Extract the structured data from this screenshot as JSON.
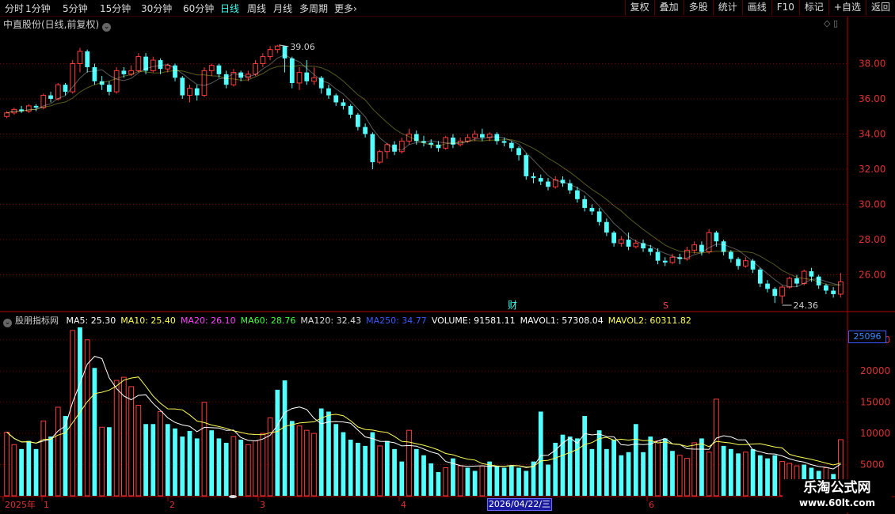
{
  "toolbar": {
    "periods": [
      "分时",
      "1分钟",
      "5分钟",
      "15分钟",
      "30分钟",
      "60分钟",
      "日线",
      "周线",
      "月线",
      "多周期",
      "更多"
    ],
    "active_index": 6,
    "right_buttons": [
      "复权",
      "叠加",
      "多股",
      "统计",
      "画线",
      "F10",
      "标记",
      "+自选",
      "返回"
    ]
  },
  "stock": {
    "title": "中直股份(日线,前复权)"
  },
  "indicator": {
    "name": "股朋指标网",
    "items": [
      {
        "label": "MA5: 25.30",
        "color": "#ffffff"
      },
      {
        "label": "MA10: 25.40",
        "color": "#ffff55"
      },
      {
        "label": "MA20: 26.10",
        "color": "#ff44ff"
      },
      {
        "label": "MA60: 28.76",
        "color": "#44ff44"
      },
      {
        "label": "MA120: 32.43",
        "color": "#dddddd"
      },
      {
        "label": "MA250: 34.77",
        "color": "#3a5aff"
      },
      {
        "label": "VOLUME: 91581.11",
        "color": "#ffffff"
      },
      {
        "label": "MAVOL1: 57308.04",
        "color": "#ffffff"
      },
      {
        "label": "MAVOL2: 60311.82",
        "color": "#ffff55"
      }
    ]
  },
  "markers": {
    "fin": "财",
    "s": "S"
  },
  "cursor": {
    "value": "25096",
    "date": "2026/04/22/三"
  },
  "watermark": {
    "title": "乐淘公式网",
    "url": "www.60lt.com"
  },
  "colors": {
    "up": "#ff3c3c",
    "down": "#54ffff",
    "grid": "#7a0000",
    "bg": "#000000"
  },
  "chart_data": {
    "type": "candlestick",
    "price_ticks": [
      "38.00",
      "36.00",
      "34.00",
      "32.00",
      "30.00",
      "28.00",
      "26.00"
    ],
    "volume_ticks": [
      "25000",
      "20000",
      "15000",
      "10000",
      "5000"
    ],
    "price_ylim": [
      24.0,
      40.0
    ],
    "volume_ylim": [
      0,
      27000
    ],
    "x_labels": [
      "2025年",
      "1",
      "2",
      "3",
      "4",
      "6"
    ],
    "high_label": "39.06",
    "low_label": "24.36",
    "candles": [
      [
        35.0,
        35.2,
        34.9,
        35.3
      ],
      [
        35.2,
        35.4,
        35.1,
        35.5
      ],
      [
        35.4,
        35.3,
        35.2,
        35.6
      ],
      [
        35.3,
        35.6,
        35.2,
        35.7
      ],
      [
        35.6,
        35.5,
        35.3,
        35.7
      ],
      [
        35.5,
        36.2,
        35.4,
        36.3
      ],
      [
        36.2,
        36.0,
        35.8,
        36.4
      ],
      [
        36.0,
        36.8,
        35.9,
        36.9
      ],
      [
        36.8,
        36.4,
        36.2,
        36.9
      ],
      [
        36.4,
        38.0,
        36.3,
        38.2
      ],
      [
        38.0,
        38.7,
        37.5,
        38.9
      ],
      [
        38.7,
        37.8,
        37.5,
        38.8
      ],
      [
        37.8,
        37.0,
        36.8,
        38.0
      ],
      [
        37.0,
        36.8,
        36.5,
        37.3
      ],
      [
        36.8,
        36.4,
        36.2,
        37.0
      ],
      [
        36.4,
        37.6,
        36.3,
        37.8
      ],
      [
        37.6,
        37.4,
        37.2,
        37.8
      ],
      [
        37.4,
        37.6,
        37.3,
        37.9
      ],
      [
        37.6,
        38.4,
        37.5,
        38.6
      ],
      [
        38.4,
        37.6,
        37.4,
        38.6
      ],
      [
        37.6,
        38.2,
        37.5,
        38.4
      ],
      [
        38.2,
        37.7,
        37.4,
        38.3
      ],
      [
        37.7,
        37.9,
        37.5,
        38.0
      ],
      [
        37.9,
        37.2,
        37.0,
        38.0
      ],
      [
        37.2,
        36.2,
        36.0,
        37.3
      ],
      [
        36.2,
        36.6,
        35.8,
        36.8
      ],
      [
        36.6,
        36.2,
        35.9,
        36.8
      ],
      [
        36.2,
        37.6,
        36.1,
        37.8
      ],
      [
        37.6,
        37.9,
        37.3,
        38.0
      ],
      [
        37.9,
        37.4,
        37.2,
        38.0
      ],
      [
        37.4,
        36.8,
        36.6,
        37.6
      ],
      [
        36.8,
        37.5,
        36.7,
        37.7
      ],
      [
        37.5,
        37.2,
        37.0,
        37.6
      ],
      [
        37.2,
        37.4,
        37.0,
        37.6
      ],
      [
        37.4,
        38.0,
        37.3,
        38.2
      ],
      [
        38.0,
        38.4,
        37.8,
        38.6
      ],
      [
        38.4,
        38.8,
        38.2,
        39.0
      ],
      [
        38.8,
        39.0,
        38.6,
        39.06
      ],
      [
        39.0,
        38.3,
        37.5,
        39.0
      ],
      [
        38.3,
        36.9,
        36.6,
        38.4
      ],
      [
        36.9,
        37.5,
        36.5,
        37.8
      ],
      [
        37.5,
        37.0,
        36.8,
        38.2
      ],
      [
        37.0,
        37.2,
        36.8,
        37.8
      ],
      [
        37.2,
        36.6,
        36.3,
        37.3
      ],
      [
        36.6,
        36.2,
        36.0,
        36.8
      ],
      [
        36.2,
        35.8,
        35.6,
        36.3
      ],
      [
        35.8,
        35.6,
        35.4,
        36.0
      ],
      [
        35.6,
        35.1,
        34.9,
        35.7
      ],
      [
        35.1,
        34.4,
        34.2,
        35.2
      ],
      [
        34.4,
        34.0,
        33.8,
        34.6
      ],
      [
        34.0,
        32.4,
        32.0,
        34.1
      ],
      [
        32.4,
        33.0,
        32.3,
        33.1
      ],
      [
        33.0,
        33.4,
        32.6,
        33.5
      ],
      [
        33.4,
        33.0,
        32.8,
        33.6
      ],
      [
        33.0,
        33.6,
        32.9,
        33.8
      ],
      [
        33.6,
        34.0,
        33.4,
        34.3
      ],
      [
        34.0,
        33.6,
        33.4,
        34.2
      ],
      [
        33.6,
        33.5,
        33.3,
        33.9
      ],
      [
        33.5,
        33.4,
        33.2,
        33.7
      ],
      [
        33.4,
        33.2,
        33.0,
        33.6
      ],
      [
        33.2,
        33.8,
        33.1,
        33.9
      ],
      [
        33.8,
        33.4,
        33.2,
        34.0
      ],
      [
        33.4,
        33.6,
        33.3,
        33.8
      ],
      [
        33.6,
        33.8,
        33.5,
        34.0
      ],
      [
        33.8,
        34.0,
        33.6,
        34.2
      ],
      [
        34.0,
        33.8,
        33.6,
        34.3
      ],
      [
        33.8,
        34.0,
        33.6,
        34.1
      ],
      [
        34.0,
        33.6,
        33.4,
        34.1
      ],
      [
        33.6,
        33.5,
        33.3,
        33.8
      ],
      [
        33.5,
        33.2,
        33.0,
        33.6
      ],
      [
        33.2,
        32.8,
        32.5,
        33.3
      ],
      [
        32.8,
        31.6,
        31.4,
        32.9
      ],
      [
        31.6,
        31.5,
        31.2,
        31.8
      ],
      [
        31.5,
        31.3,
        31.1,
        31.7
      ],
      [
        31.3,
        31.0,
        30.8,
        31.5
      ],
      [
        31.0,
        31.4,
        30.9,
        31.6
      ],
      [
        31.4,
        31.2,
        31.0,
        31.6
      ],
      [
        31.2,
        30.8,
        30.6,
        31.4
      ],
      [
        30.8,
        30.3,
        30.1,
        31.0
      ],
      [
        30.3,
        29.8,
        29.6,
        30.5
      ],
      [
        29.8,
        29.6,
        29.4,
        30.0
      ],
      [
        29.6,
        29.0,
        28.8,
        29.8
      ],
      [
        29.0,
        28.4,
        28.2,
        29.2
      ],
      [
        28.4,
        27.8,
        27.6,
        28.5
      ],
      [
        27.8,
        28.0,
        27.6,
        28.2
      ],
      [
        28.0,
        27.6,
        27.4,
        28.4
      ],
      [
        27.6,
        27.8,
        27.5,
        28.0
      ],
      [
        27.8,
        27.5,
        27.3,
        28.0
      ],
      [
        27.5,
        27.3,
        27.1,
        27.7
      ],
      [
        27.3,
        26.8,
        26.6,
        27.5
      ],
      [
        26.8,
        26.7,
        26.5,
        27.0
      ],
      [
        26.7,
        27.0,
        26.6,
        27.2
      ],
      [
        27.0,
        26.9,
        26.6,
        27.2
      ],
      [
        26.9,
        27.4,
        26.8,
        27.6
      ],
      [
        27.4,
        27.7,
        27.2,
        27.9
      ],
      [
        27.7,
        27.3,
        27.1,
        27.9
      ],
      [
        27.3,
        28.4,
        27.2,
        28.6
      ],
      [
        28.4,
        27.9,
        27.6,
        28.5
      ],
      [
        27.9,
        27.3,
        27.1,
        28.0
      ],
      [
        27.3,
        26.9,
        26.7,
        27.4
      ],
      [
        26.9,
        26.5,
        26.3,
        27.0
      ],
      [
        26.5,
        26.8,
        26.4,
        27.0
      ],
      [
        26.8,
        26.3,
        26.1,
        26.9
      ],
      [
        26.3,
        25.5,
        25.3,
        26.4
      ],
      [
        25.5,
        25.2,
        25.0,
        25.7
      ],
      [
        25.2,
        24.8,
        24.4,
        25.3
      ],
      [
        24.8,
        25.3,
        24.36,
        25.4
      ],
      [
        25.3,
        25.8,
        25.2,
        25.9
      ],
      [
        25.8,
        25.5,
        25.3,
        26.0
      ],
      [
        25.5,
        26.2,
        25.4,
        26.3
      ],
      [
        26.2,
        25.9,
        25.6,
        26.4
      ],
      [
        25.9,
        25.4,
        25.2,
        26.0
      ],
      [
        25.4,
        25.1,
        24.9,
        25.5
      ],
      [
        25.1,
        24.9,
        24.7,
        25.3
      ],
      [
        24.9,
        25.6,
        24.7,
        26.1
      ]
    ],
    "volumes": [
      [
        10200,
        1
      ],
      [
        8200,
        1
      ],
      [
        7500,
        0
      ],
      [
        8800,
        0
      ],
      [
        7500,
        0
      ],
      [
        12000,
        1
      ],
      [
        9500,
        0
      ],
      [
        14200,
        1
      ],
      [
        12800,
        0
      ],
      [
        26500,
        1
      ],
      [
        27000,
        0
      ],
      [
        25000,
        1
      ],
      [
        20500,
        0
      ],
      [
        11000,
        1
      ],
      [
        11000,
        0
      ],
      [
        18500,
        1
      ],
      [
        19000,
        1
      ],
      [
        17500,
        1
      ],
      [
        14500,
        1
      ],
      [
        11500,
        0
      ],
      [
        11500,
        0
      ],
      [
        13500,
        1
      ],
      [
        11500,
        0
      ],
      [
        10800,
        0
      ],
      [
        9500,
        0
      ],
      [
        10400,
        0
      ],
      [
        9200,
        0
      ],
      [
        15000,
        1
      ],
      [
        10500,
        0
      ],
      [
        9200,
        0
      ],
      [
        8500,
        0
      ],
      [
        9500,
        1
      ],
      [
        9000,
        0
      ],
      [
        8200,
        1
      ],
      [
        8800,
        1
      ],
      [
        10000,
        1
      ],
      [
        12500,
        1
      ],
      [
        17000,
        0
      ],
      [
        18500,
        0
      ],
      [
        12000,
        0
      ],
      [
        11200,
        1
      ],
      [
        10500,
        1
      ],
      [
        10000,
        1
      ],
      [
        14000,
        0
      ],
      [
        13500,
        0
      ],
      [
        11500,
        0
      ],
      [
        10200,
        0
      ],
      [
        9000,
        0
      ],
      [
        8500,
        0
      ],
      [
        8000,
        0
      ],
      [
        10200,
        0
      ],
      [
        8000,
        1
      ],
      [
        8800,
        0
      ],
      [
        7500,
        0
      ],
      [
        5500,
        0
      ],
      [
        10500,
        1
      ],
      [
        7500,
        0
      ],
      [
        6500,
        0
      ],
      [
        5200,
        0
      ],
      [
        3800,
        0
      ],
      [
        4500,
        1
      ],
      [
        6000,
        0
      ],
      [
        4800,
        1
      ],
      [
        4500,
        0
      ],
      [
        4000,
        0
      ],
      [
        4800,
        1
      ],
      [
        5500,
        0
      ],
      [
        4800,
        0
      ],
      [
        4500,
        0
      ],
      [
        4800,
        0
      ],
      [
        4500,
        0
      ],
      [
        4000,
        0
      ],
      [
        5500,
        0
      ],
      [
        13500,
        0
      ],
      [
        5000,
        0
      ],
      [
        8500,
        0
      ],
      [
        9800,
        0
      ],
      [
        9500,
        0
      ],
      [
        9200,
        0
      ],
      [
        12800,
        0
      ],
      [
        7500,
        0
      ],
      [
        10500,
        0
      ],
      [
        7500,
        0
      ],
      [
        9000,
        0
      ],
      [
        6500,
        0
      ],
      [
        7000,
        0
      ],
      [
        11500,
        0
      ],
      [
        7000,
        0
      ],
      [
        9500,
        0
      ],
      [
        8800,
        1
      ],
      [
        9200,
        0
      ],
      [
        7200,
        0
      ],
      [
        6500,
        1
      ],
      [
        6000,
        1
      ],
      [
        8500,
        1
      ],
      [
        9200,
        0
      ],
      [
        7000,
        1
      ],
      [
        15500,
        1
      ],
      [
        8000,
        0
      ],
      [
        7500,
        0
      ],
      [
        6800,
        0
      ],
      [
        7000,
        1
      ],
      [
        7500,
        0
      ],
      [
        6500,
        0
      ],
      [
        6000,
        0
      ],
      [
        6500,
        0
      ],
      [
        5500,
        1
      ],
      [
        5200,
        1
      ],
      [
        4800,
        1
      ],
      [
        5000,
        0
      ],
      [
        4500,
        0
      ],
      [
        4000,
        0
      ],
      [
        4500,
        1
      ],
      [
        3500,
        0
      ],
      [
        9000,
        1
      ]
    ],
    "ma_price": [
      {
        "name": "MA5",
        "color": "#ffffff"
      },
      {
        "name": "MA10",
        "color": "#ffff55"
      }
    ],
    "ma_volume": [
      {
        "name": "MAVOL1",
        "color": "#ffffff",
        "window": 5
      },
      {
        "name": "MAVOL2",
        "color": "#ffff55",
        "window": 10
      }
    ]
  }
}
